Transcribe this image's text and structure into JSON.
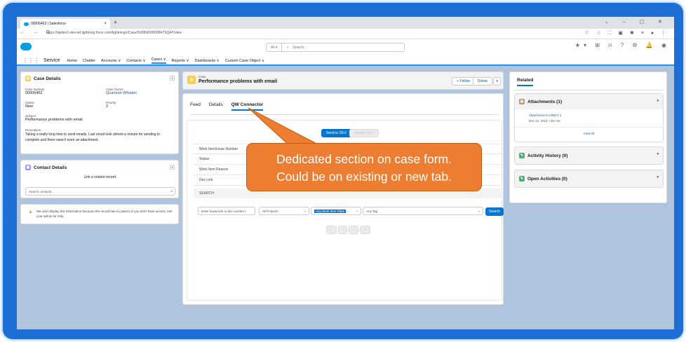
{
  "browser": {
    "tab_title": "00006462 | Salesforce",
    "tab_close": "×",
    "new_tab": "+",
    "window_controls": "⌄  –  ▢  ✕",
    "nav_buttons": "← → C",
    "url": "https://qwdev1-dev-ed.lightning.force.com/lightning/r/Case/5008W00000847SQAY/view",
    "ext_icons": "⚐ ☆ ⛶ ▣ ✱ ≡ ● ⋮"
  },
  "header": {
    "search_scope": "All ▾",
    "search_placeholder": "Search...",
    "icons": "★▾ ⊞ ⍾ ? ⚙ 🔔 ◉"
  },
  "appnav": {
    "app_name": "Service",
    "items": [
      "Home",
      "Chatter",
      "Accounts ∨",
      "Contacts ∨",
      "Cases ∨",
      "Reports ∨",
      "Dashboards ∨",
      "Custom Case Object ∨"
    ],
    "active_index": 4
  },
  "case_details": {
    "title": "Case Details",
    "case_number_label": "Case Number",
    "case_number": "00006462",
    "owner_label": "Case Owner",
    "owner": "Quantum Whisper",
    "status_label": "Status",
    "status": "New",
    "priority_label": "Priority",
    "priority": "2",
    "subject_label": "Subject",
    "subject": "Performance problems with email",
    "description_label": "Description",
    "description": "Taking a really long time to send emails. Last email took almost a minute for sending to complete and there wasn't even an attachment."
  },
  "contact_details": {
    "title": "Contact Details",
    "link_text": "Link a related record.",
    "search_placeholder": "Search contacts..."
  },
  "warning": {
    "text": "We can't display this information because the record has no parent or you don't have access. Ask your admin for help."
  },
  "case_header": {
    "object": "Case",
    "title": "Performance problems with email",
    "follow": "+ Follow",
    "delete": "Delete",
    "menu": "▾"
  },
  "tabs": [
    "Feed",
    "Details",
    "QW Connector"
  ],
  "qw": {
    "send_label": "Send to DEV",
    "update_label": "Update DEV",
    "rows": [
      "Work Item/Issue Number",
      "Status",
      "Work Item Reason",
      "Dev Link"
    ],
    "search_heading": "SEARCH",
    "search_placeholder": "Enter keywords or dev number t",
    "project": "All Projects",
    "state": "Any Work Item State",
    "tag": "Any Tag",
    "search_button": "Search",
    "pager": [
      "«",
      "‹",
      "›",
      "»"
    ]
  },
  "related": {
    "tab": "Related",
    "attachments_title": "Attachments (1)",
    "attachment_name": "Attachment in CRM # 1",
    "attachment_meta": "Dec 21, 2021 • 48 • txt",
    "view_all": "View All",
    "activity_title": "Activity History (0)",
    "open_title": "Open Activities (0)"
  },
  "callout": {
    "line1": "Dedicated section on case form.",
    "line2": "Could be on existing or new tab."
  },
  "colors": {
    "frame": "#1d6fd6",
    "brand": "#0176d3",
    "callout": "#ed7d31",
    "background": "#b0c4de"
  }
}
